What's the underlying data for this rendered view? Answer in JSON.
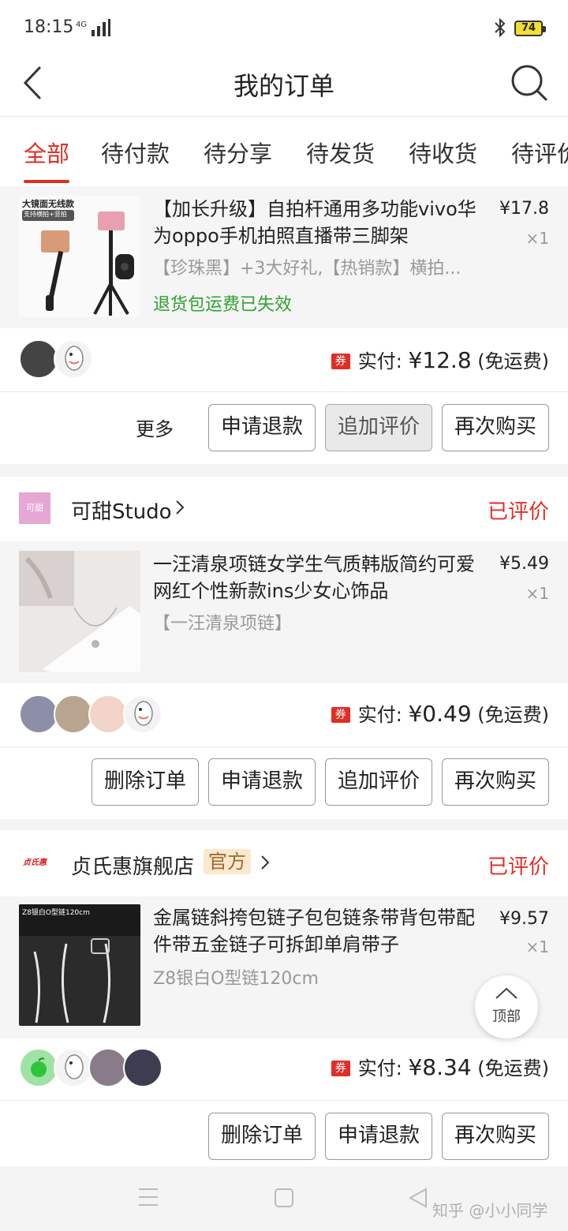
{
  "status": {
    "time": "18:15",
    "signal": "4G",
    "battery": "74"
  },
  "header": {
    "title": "我的订单"
  },
  "tabs": [
    "全部",
    "待付款",
    "待分享",
    "待发货",
    "待收货",
    "待评价"
  ],
  "orders": [
    {
      "product": {
        "title": "【加长升级】自拍杆通用多功能vivo华为oppo手机拍照直播带三脚架",
        "spec": "【珍珠黑】+3大好礼,【热销款】横拍...",
        "note": "退货包运费已失效",
        "price": "¥17.8",
        "qty": "×1",
        "thumb_caption": "大镜面无线款",
        "thumb_badge": "支持横拍+竖拍"
      },
      "payment": {
        "coupon": "券",
        "label": "实付: ",
        "amount": "¥12.8",
        "shipping": " (免运费)"
      },
      "actions": {
        "more": "更多",
        "refund": "申请退款",
        "review": "追加评价",
        "rebuy": "再次购买"
      }
    },
    {
      "shop": {
        "logo": "可甜",
        "name": "可甜Studo",
        "status": "已评价"
      },
      "product": {
        "title": "一汪清泉项链女学生气质韩版简约可爱网红个性新款ins少女心饰品",
        "spec": "【一汪清泉项链】",
        "price": "¥5.49",
        "qty": "×1"
      },
      "payment": {
        "coupon": "券",
        "label": "实付: ",
        "amount": "¥0.49",
        "shipping": " (免运费)"
      },
      "actions": {
        "delete": "删除订单",
        "refund": "申请退款",
        "review": "追加评价",
        "rebuy": "再次购买"
      }
    },
    {
      "shop": {
        "logo": "贞氏惠",
        "name": "贞氏惠旗舰店",
        "badge": "官方",
        "status": "已评价"
      },
      "product": {
        "title": "金属链斜挎包链子包包链条带背包带配件带五金链子可拆卸单肩带子",
        "spec": "Z8银白O型链120cm",
        "price": "¥9.57",
        "qty": "×1",
        "thumb_caption": "Z8银白O型链120cm"
      },
      "payment": {
        "coupon": "券",
        "label": "实付: ",
        "amount": "¥8.34",
        "shipping": " (免运费)"
      },
      "actions": {
        "delete": "删除订单",
        "refund": "申请退款",
        "rebuy": "再次购买"
      }
    }
  ],
  "float": {
    "top_label": "顶部"
  },
  "watermark": "知乎 @小小同学",
  "colors": {
    "accent": "#e02e24",
    "green": "#2fa22f",
    "official_bg": "#fbe8cf"
  }
}
